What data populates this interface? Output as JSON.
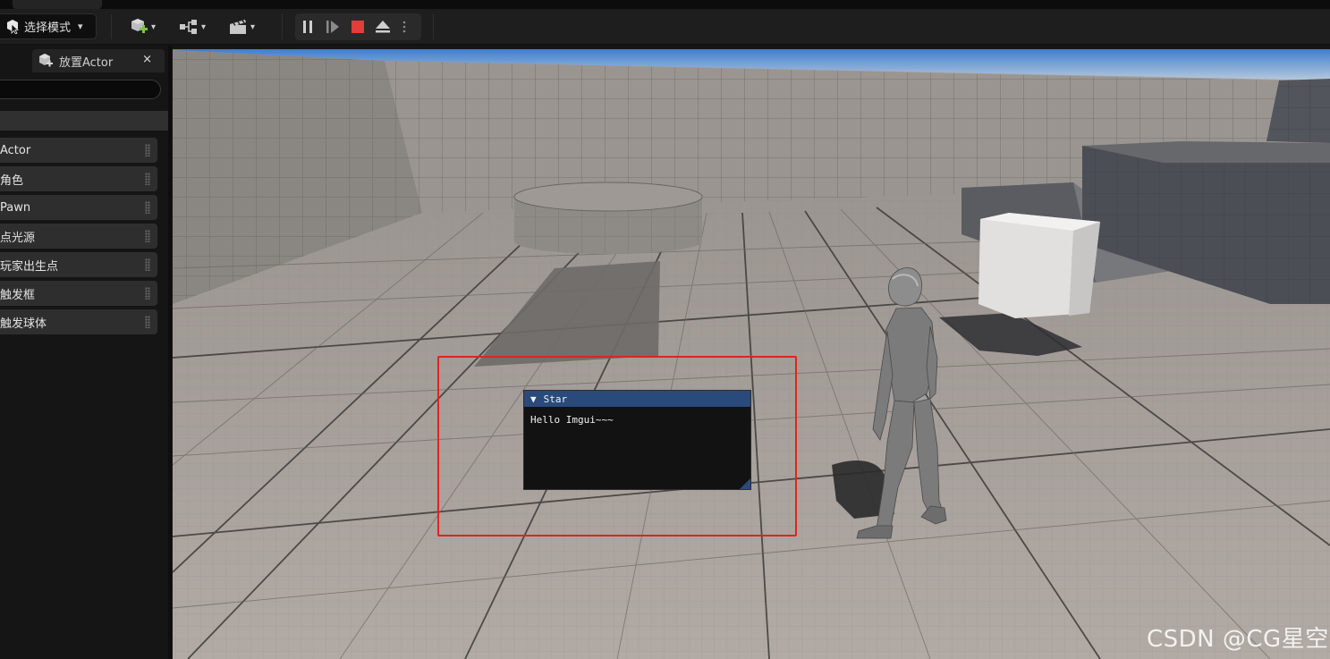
{
  "toolbar": {
    "mode_label": "选择模式",
    "icons": [
      "add-actor-icon",
      "blueprint-icon",
      "cinematics-icon"
    ],
    "play_controls": [
      "pause-icon",
      "step-icon",
      "stop-icon",
      "eject-icon",
      "more-icon"
    ]
  },
  "left_panel": {
    "tab_label": "放置Actor",
    "close_label": "×",
    "search": {
      "value": "",
      "placeholder": ""
    },
    "items": [
      {
        "label": "Actor"
      },
      {
        "label": "角色"
      },
      {
        "label": "Pawn"
      },
      {
        "label": "点光源"
      },
      {
        "label": "玩家出生点"
      },
      {
        "label": "触发框"
      },
      {
        "label": "触发球体"
      }
    ]
  },
  "imgui_window": {
    "title": "Star",
    "collapse_glyph": "▼",
    "text": "Hello Imgui~~~"
  },
  "colors": {
    "imgui_title": "#294a7a",
    "highlight": "#e2231a",
    "stop_button": "#e43b3b",
    "add_icon_accent": "#7ec24a"
  },
  "watermark": "CSDN @CG星空"
}
